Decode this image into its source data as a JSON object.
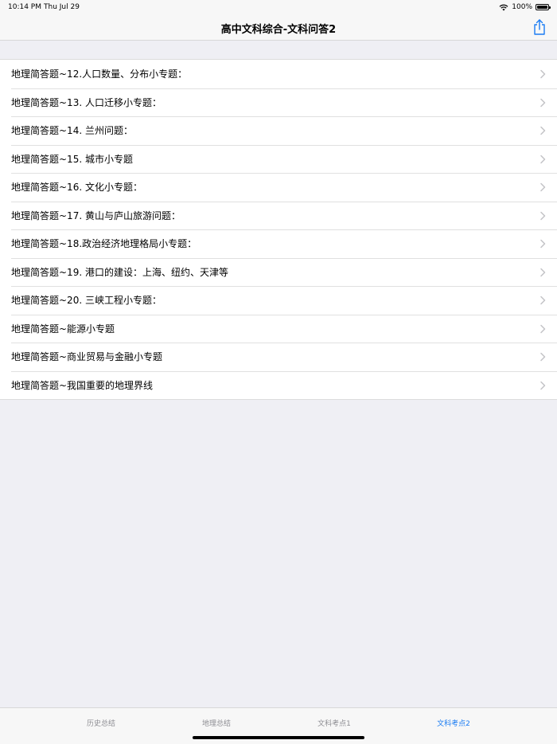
{
  "status_bar": {
    "time": "10:14 PM",
    "date": "Thu Jul 29",
    "battery_percent": "100%",
    "icons": [
      "wifi-icon",
      "battery-icon"
    ]
  },
  "nav": {
    "title": "高中文科综合-文科问答2",
    "share_icon": "share-icon",
    "accent_color": "#1a7cf3"
  },
  "list": {
    "items": [
      {
        "label": "地理简答题~12.人口数量、分布小专题："
      },
      {
        "label": "地理简答题~13. 人口迁移小专题："
      },
      {
        "label": "地理简答题~14. 兰州问题："
      },
      {
        "label": "地理简答题~15. 城市小专题"
      },
      {
        "label": "地理简答题~16. 文化小专题："
      },
      {
        "label": "地理简答题~17. 黄山与庐山旅游问题："
      },
      {
        "label": "地理简答题~18.政治经济地理格局小专题："
      },
      {
        "label": "地理简答题~19. 港口的建设：上海、纽约、天津等"
      },
      {
        "label": "地理简答题~20. 三峡工程小专题："
      },
      {
        "label": "地理简答题~能源小专题"
      },
      {
        "label": "地理简答题~商业贸易与金融小专题"
      },
      {
        "label": "地理简答题~我国重要的地理界线"
      }
    ],
    "chevron_icon": "chevron-right-icon"
  },
  "tab_bar": {
    "tabs": [
      {
        "label": "历史总结",
        "active": false
      },
      {
        "label": "地理总结",
        "active": false
      },
      {
        "label": "文科考点1",
        "active": false
      },
      {
        "label": "文科考点2",
        "active": true
      }
    ]
  }
}
